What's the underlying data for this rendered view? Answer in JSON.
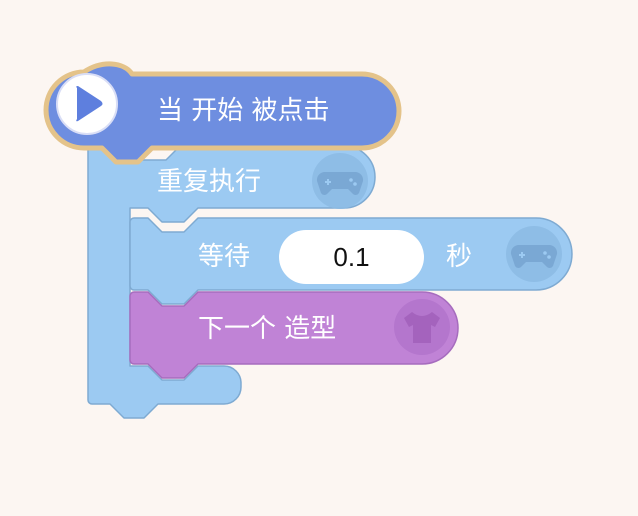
{
  "blocks": {
    "hat": {
      "label": "当 开始 被点击",
      "icon": "play-icon",
      "fill": "#6e8ee0",
      "outline": "#e4c38a"
    },
    "repeat": {
      "label": "重复执行",
      "icon": "gamepad-icon",
      "fill": "#9ccaf2",
      "stroke": "#7eaad2"
    },
    "wait": {
      "label_before": "等待",
      "value": "0.1",
      "label_after": "秒",
      "icon": "gamepad-icon"
    },
    "next_costume": {
      "label": "下一个 造型",
      "icon": "shirt-icon",
      "fill": "#c083d6",
      "stroke": "#a66cbe"
    }
  }
}
